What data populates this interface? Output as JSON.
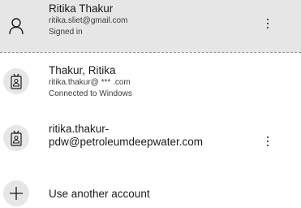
{
  "accounts": [
    {
      "name": "Ritika Thakur",
      "email": "ritika.sliet@gmail.com",
      "status": "Signed in",
      "icon": "person-icon"
    },
    {
      "name": "Thakur, Ritika",
      "email": "ritika.thakur@ *** .com",
      "status": "Connected to Windows",
      "icon": "work-badge-icon"
    },
    {
      "email_line1": "ritika.thakur-",
      "email_line2": "pdw@petroleumdeepwater.com",
      "icon": "work-badge-icon"
    }
  ],
  "add_account": {
    "label": "Use another account",
    "icon": "plus-icon"
  }
}
